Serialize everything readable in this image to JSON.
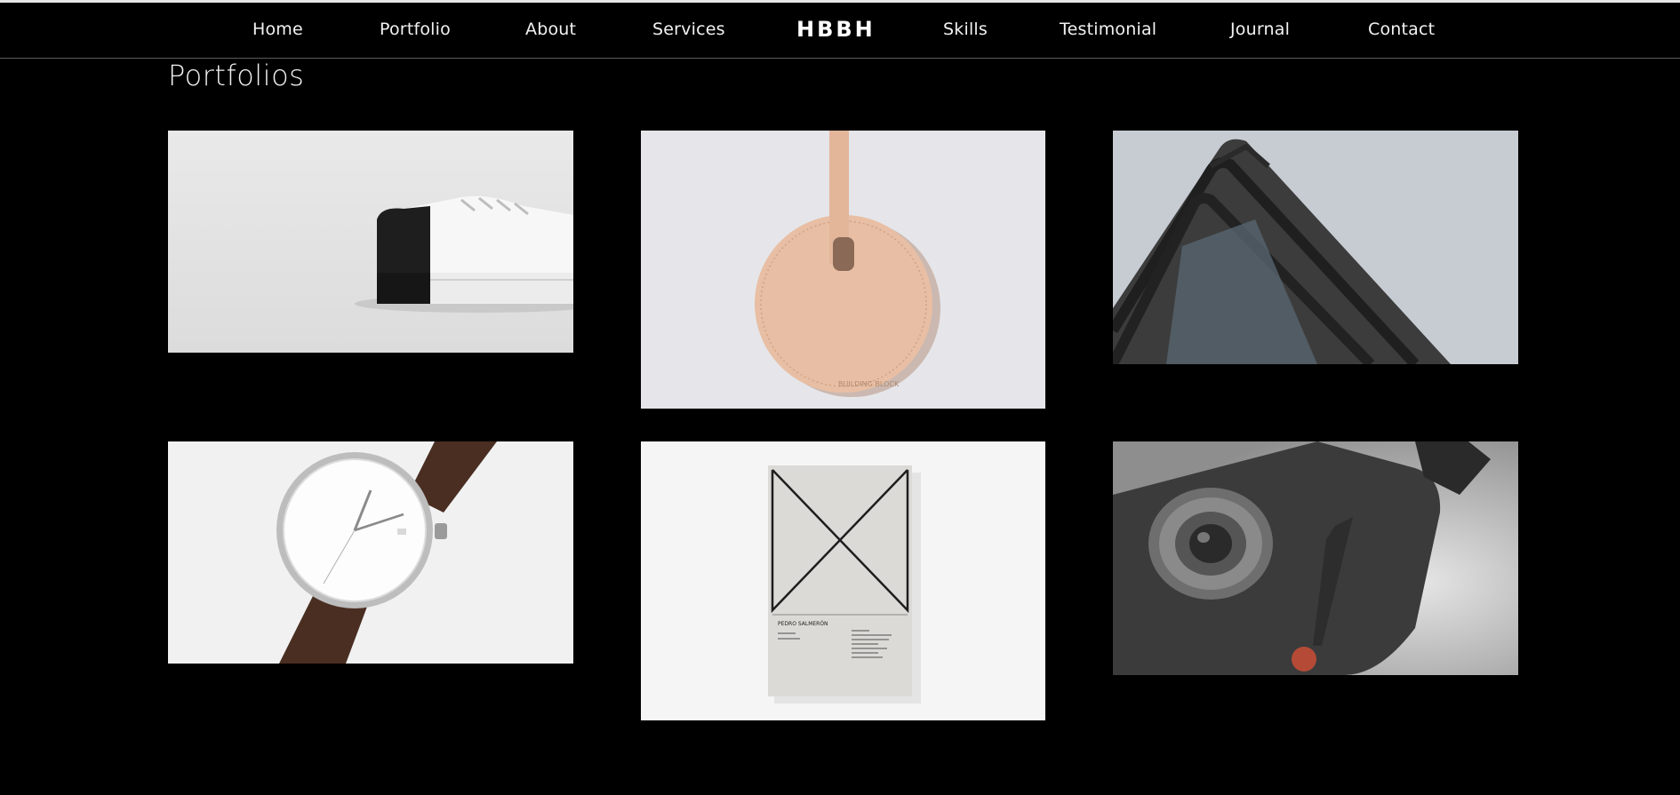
{
  "nav": {
    "home": "Home",
    "portfolio": "Portfolio",
    "about": "About",
    "services": "Services",
    "logo": "HBBH",
    "skills": "Skills",
    "testimonial": "Testimonial",
    "journal": "Journal",
    "contact": "Contact"
  },
  "section": {
    "title": "Portfolios"
  },
  "portfolio_items": [
    {
      "subject": "sneaker-image",
      "tag_text": ""
    },
    {
      "subject": "leather-tag-image",
      "tag_text": "BUILDING BLOCK"
    },
    {
      "subject": "building-image",
      "tag_text": ""
    },
    {
      "subject": "watch-image",
      "tag_text": ""
    },
    {
      "subject": "book-cover-image",
      "tag_text": "PEDRO SALMERÓN"
    },
    {
      "subject": "camera-image",
      "tag_text": ""
    }
  ],
  "colors": {
    "background": "#000000",
    "nav_text": "#f2f2f2",
    "divider": "#5a5a5a"
  }
}
